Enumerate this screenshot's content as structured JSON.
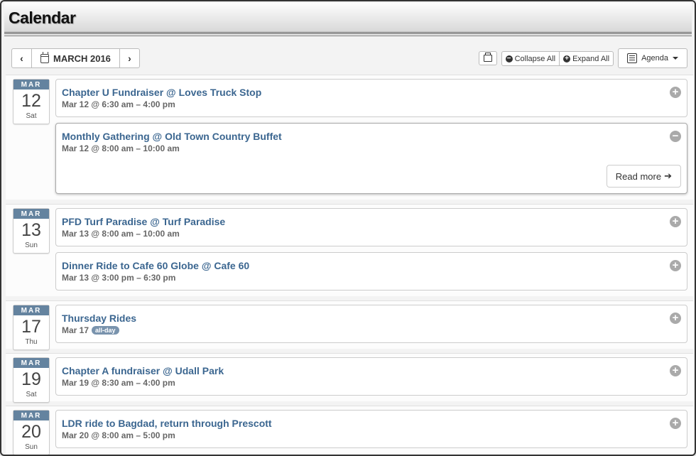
{
  "page": {
    "title": "Calendar"
  },
  "toolbar": {
    "prev_icon": "‹",
    "next_icon": "›",
    "month_label": "MARCH 2016",
    "collapse_label": "Collapse All",
    "expand_label": "Expand All",
    "view_label": "Agenda"
  },
  "days": [
    {
      "month": "MAR",
      "day": "12",
      "weekday": "Sat",
      "events": [
        {
          "title": "Chapter U Fundraiser @ Loves Truck Stop",
          "time": "Mar 12 @ 6:30 am – 4:00 pm",
          "toggle": "+"
        },
        {
          "title": "Monthly Gathering @ Old Town Country Buffet",
          "time": "Mar 12 @ 8:00 am – 10:00 am",
          "toggle": "−",
          "read_more": "Read more"
        }
      ]
    },
    {
      "month": "MAR",
      "day": "13",
      "weekday": "Sun",
      "events": [
        {
          "title": "PFD Turf Paradise @ Turf Paradise",
          "time": "Mar 13 @ 8:00 am – 10:00 am",
          "toggle": "+"
        },
        {
          "title": "Dinner Ride to Cafe 60 Globe @ Cafe 60",
          "time": "Mar 13 @ 3:00 pm – 6:30 pm",
          "toggle": "+"
        }
      ]
    },
    {
      "month": "MAR",
      "day": "17",
      "weekday": "Thu",
      "events": [
        {
          "title": "Thursday Rides",
          "time": "Mar 17",
          "badge": "all-day",
          "toggle": "+"
        }
      ]
    },
    {
      "month": "MAR",
      "day": "19",
      "weekday": "Sat",
      "events": [
        {
          "title": "Chapter A fundraiser @ Udall Park",
          "time": "Mar 19 @ 8:30 am – 4:00 pm",
          "toggle": "+"
        }
      ]
    },
    {
      "month": "MAR",
      "day": "20",
      "weekday": "Sun",
      "events": [
        {
          "title": "LDR ride to Bagdad, return through Prescott",
          "time": "Mar 20 @ 8:00 am – 5:00 pm",
          "toggle": "+"
        }
      ]
    }
  ]
}
